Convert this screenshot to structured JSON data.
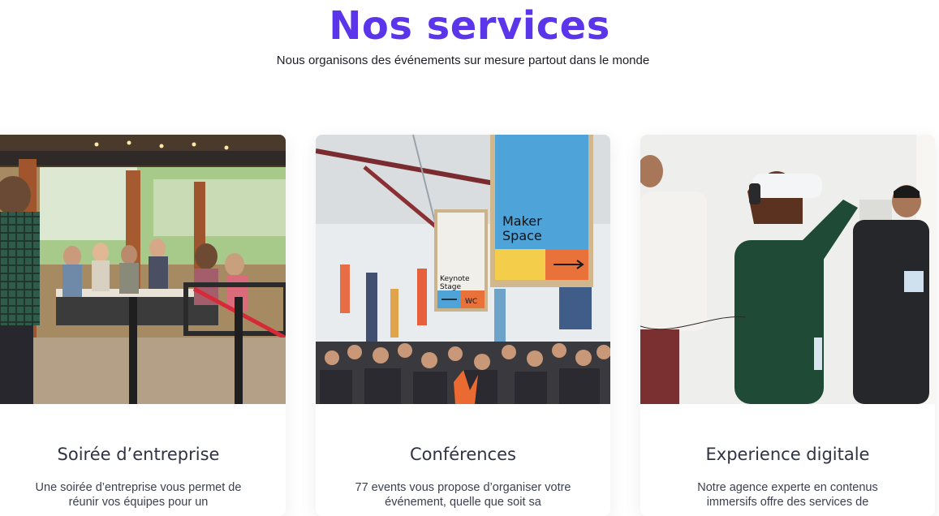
{
  "header": {
    "title": "Nos services",
    "subtitle": "Nous organisons des événements sur mesure partout dans le monde"
  },
  "cards": [
    {
      "title": "Soirée d’entreprise",
      "text": "Une soirée d’entreprise vous permet de réunir vos équipes pour un"
    },
    {
      "title": "Conférences",
      "text": "77 events vous propose d’organiser votre événement, quelle que soit sa",
      "signs": {
        "maker": "Maker Space",
        "keynote": "Keynote Stage",
        "wc": "WC"
      }
    },
    {
      "title": "Experience digitale",
      "text": "Notre agence experte en contenus immersifs offre des services de"
    }
  ],
  "colors": {
    "accent": "#5b35ea",
    "card_title": "#2f3342",
    "body_text": "#3c4050"
  }
}
